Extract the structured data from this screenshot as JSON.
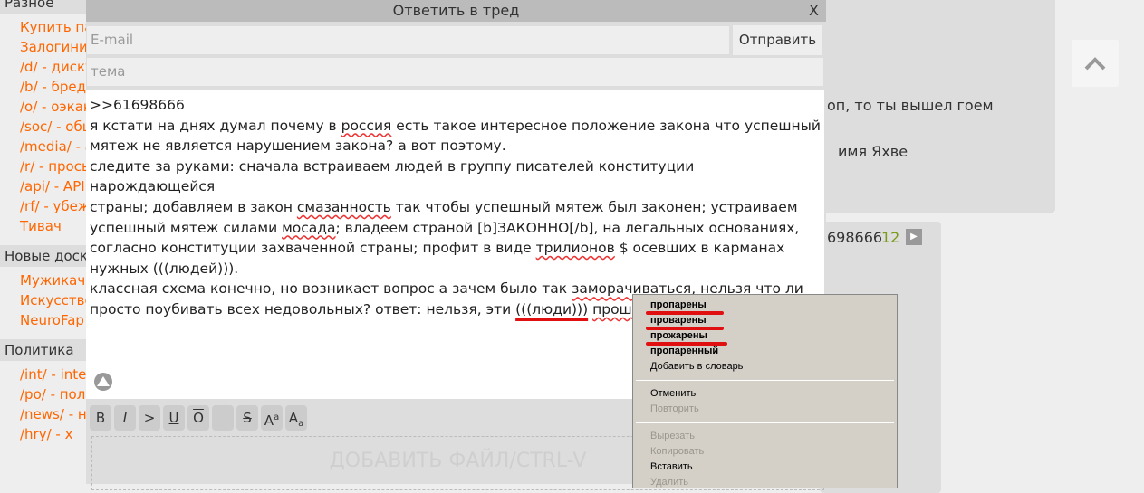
{
  "sidebar": {
    "sections": [
      {
        "title": "Разное",
        "items": [
          "Купить пасскод",
          "Залогиниться",
          "/d/ - дискуссии",
          "/b/ - бред",
          "/o/ - оэкаки",
          "/soc/ - общение",
          "/media/ - анимация",
          "/r/ - просьбы",
          "/api/ - API",
          "/rf/ - убежище",
          "Тивач"
        ]
      },
      {
        "title": "Новые доски",
        "items": [
          "Мужикач",
          "Искусственный",
          "NeuroFap"
        ]
      },
      {
        "title": "Политика",
        "items": [
          "/int/ - international",
          "/po/ - политика",
          "/news/ - новости",
          "/hry/ - х"
        ]
      }
    ]
  },
  "background": {
    "post1_line1": "оп, то ты вышел гоем",
    "post1_line2": "имя Яхве",
    "post2_ref": "698666",
    "post2_count": "12"
  },
  "modal": {
    "title": "Ответить в тред",
    "close": "X",
    "email_placeholder": "E-mail",
    "send": "Отправить",
    "subject_placeholder": "тема",
    "message_lines": [
      ">>61698666",
      "я кстати на днях думал почему в россия есть такое интересное положение закона что успешный",
      "мятеж не является нарушением закона? а вот поэтому.",
      "следите за руками: сначала встраиваем людей в группу писателей конституции нарождающейся",
      "страны; добавляем в закон смазанность так чтобы успешный мятеж был законен; устраиваем",
      "успешный мятеж силами мосада; владеем страной [b]ЗАКОННО[/b], на легальных основаниях,",
      "согласно конституции захваченной страны; профит в виде трилионов $ осевших в карманах",
      "нужных (((людей))).",
      "классная схема конечно, но возникает вопрос а зачем было так заморачиваться, нельзя что ли",
      "просто поубивать всех недовольных? ответ: нельзя, эти (((люди))) прошарены"
    ],
    "toolbar": [
      "B",
      "I",
      ">",
      "U",
      "O",
      "",
      "S",
      "Aa",
      "Aa"
    ],
    "drop_label": "ДОБАВИТЬ ФАЙЛ/CTRL-V"
  },
  "context_menu": {
    "suggestions": [
      "пропарены",
      "проварены",
      "прожарены",
      "пропаренный"
    ],
    "add_to_dict": "Добавить в словарь",
    "undo": "Отменить",
    "redo": "Повторить",
    "cut": "Вырезать",
    "copy": "Копировать",
    "paste": "Вставить",
    "delete": "Удалить"
  },
  "colors": {
    "link": "#ff6600",
    "annotation": "#e01010",
    "count": "#7a9a1a"
  }
}
